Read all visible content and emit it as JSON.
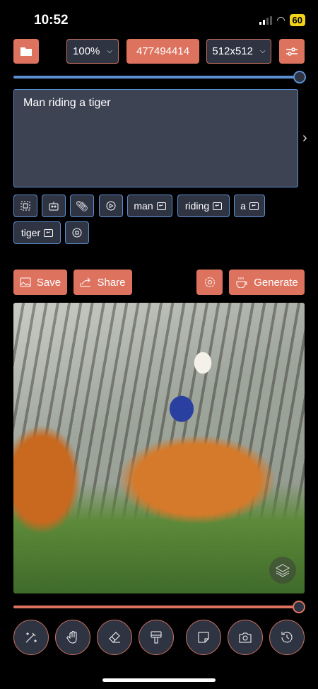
{
  "status_bar": {
    "time": "10:52",
    "battery": "60"
  },
  "toolbar": {
    "zoom": "100%",
    "seed": "477494414",
    "size": "512x512"
  },
  "prompt": {
    "value": "Man riding a tiger"
  },
  "tokens": [
    "man",
    "riding",
    "a",
    "tiger"
  ],
  "actions": {
    "save": "Save",
    "share": "Share",
    "generate": "Generate"
  },
  "sliders": {
    "top_value": 1.0,
    "bottom_value": 1.0
  },
  "colors": {
    "accent": "#dd735f",
    "blue": "#5b8fd0",
    "panel": "#2f3443"
  }
}
